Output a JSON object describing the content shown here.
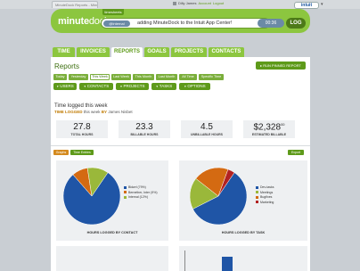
{
  "browser": {
    "tab_title": "MinuteDock Reports - MinuteDock"
  },
  "user": {
    "name": "Dilly James",
    "links": [
      "Account",
      "Logout"
    ]
  },
  "intuit": {
    "label": "intuit"
  },
  "header": {
    "logo_bold": "minute",
    "logo_thin": "dock",
    "timesheet_tab": "timesheets",
    "project_badge": "@internal",
    "entry_text": "adding MinuteDock to the Intuit App Center!",
    "timer": "00:36",
    "log_label": "LOG"
  },
  "nav": {
    "tabs": [
      "TIME",
      "INVOICES",
      "REPORTS",
      "GOALS",
      "PROJECTS",
      "CONTACTS"
    ],
    "active": "REPORTS"
  },
  "reports": {
    "title": "Reports",
    "run_button": "RUN PINNED REPORT",
    "date_tabs": [
      "Today",
      "Yesterday",
      "This Week",
      "Last Week",
      "This Month",
      "Last Month",
      "All Time",
      "Specific Time"
    ],
    "active_date": "This Week",
    "filters": [
      "USERS",
      "CONTACTS",
      "PROJECTS",
      "TASKS",
      "OPTIONS"
    ]
  },
  "summary": {
    "title": "Time logged this week",
    "sub_prefix": "TIME LOGGED",
    "sub_middle": "this week",
    "sub_by": "BY",
    "sub_user": "James Nisbet"
  },
  "stats": [
    {
      "value": "27.8",
      "label": "TOTAL HOURS"
    },
    {
      "value": "23.3",
      "label": "BILLABLE HOURS"
    },
    {
      "value": "4.5",
      "label": "UNBILLABLE HOURS"
    },
    {
      "value": "$2,328",
      "unit": "00",
      "label": "ESTIMATED BILLABLE"
    }
  ],
  "buttons": {
    "graphs": "Graphs",
    "time_entries": "Time Entries",
    "export": "Export"
  },
  "colors": {
    "accent": "#8cc63f",
    "dark_accent": "#5e9a1a",
    "blue": "#1f55a6",
    "orange": "#d46a12",
    "green": "#9ab83a",
    "red": "#b22222",
    "teal": "#27a0a8",
    "purple": "#7b4aa3"
  },
  "charts": [
    {
      "title": "HOURS LOGGED BY CONTACT",
      "legend": [
        "Bidwrl (79%)",
        "Bernether, Inter (9%)",
        "Internal (12%)"
      ]
    },
    {
      "title": "HOURS LOGGED BY TASK",
      "legend": [
        "Dev-tasks",
        "Meetings",
        "Bugfixes",
        "Marketing"
      ]
    }
  ],
  "chart_data": [
    {
      "type": "pie",
      "title": "HOURS LOGGED BY CONTACT",
      "categories": [
        "Bidwrl",
        "Bernether, Inter",
        "Internal"
      ],
      "values": [
        79,
        9,
        12
      ],
      "colors": [
        "#1f55a6",
        "#d46a12",
        "#9ab83a"
      ]
    },
    {
      "type": "pie",
      "title": "HOURS LOGGED BY TASK",
      "categories": [
        "Dev-tasks",
        "Meetings",
        "Bugfixes",
        "Marketing"
      ],
      "values": [
        58,
        18,
        20,
        4
      ],
      "colors": [
        "#1f55a6",
        "#9ab83a",
        "#d46a12",
        "#b22222"
      ]
    }
  ]
}
